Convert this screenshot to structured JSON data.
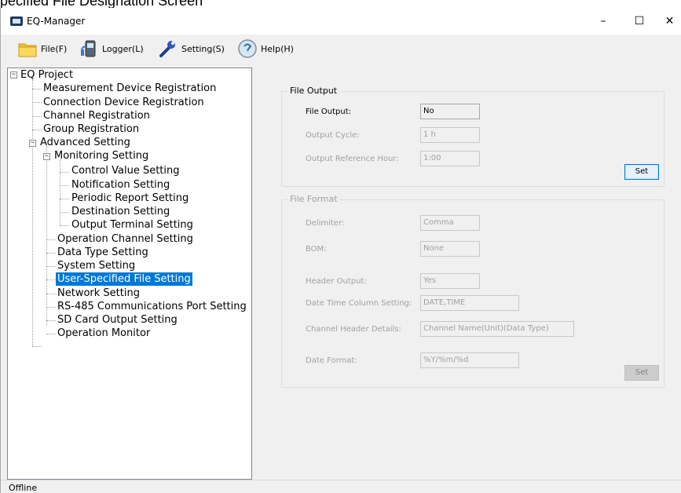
{
  "document": {
    "caption": "pecified File Designation Screen"
  },
  "window": {
    "title": "EQ-Manager",
    "minimize_glyph": "–",
    "maximize_glyph": "☐",
    "close_glyph": "✕"
  },
  "toolbar": {
    "file": {
      "label": "File(F)",
      "icon": "folder-icon"
    },
    "logger": {
      "label": "Logger(L)",
      "icon": "logger-device-icon"
    },
    "setting": {
      "label": "Setting(S)",
      "icon": "wrench-icon"
    },
    "help": {
      "label": "Help(H)",
      "icon": "help-icon"
    }
  },
  "tree": {
    "root": "EQ Project",
    "items": [
      "Measurement Device Registration",
      "Connection Device Registration",
      "Channel Registration",
      "Group Registration",
      "Advanced Setting",
      "Monitoring Setting",
      "Control Value Setting",
      "Notification Setting",
      "Periodic Report Setting",
      "Destination Setting",
      "Output Terminal Setting",
      "Operation Channel Setting",
      "Data Type Setting",
      "System Setting",
      "User-Specified File Setting",
      "Network Setting",
      "RS-485 Communications Port Setting",
      "SD Card Output Setting",
      "Operation Monitor"
    ],
    "selected": "User-Specified File Setting",
    "expander_glyph": "−"
  },
  "file_output": {
    "title": "File Output",
    "file_output_label": "File Output:",
    "file_output_value": "No",
    "output_cycle_label": "Output Cycle:",
    "output_cycle_value": "1 h",
    "ref_hour_label": "Output Reference Hour:",
    "ref_hour_value": "1:00",
    "set_label": "Set"
  },
  "file_format": {
    "title": "File Format",
    "delimiter_label": "Delimiter:",
    "delimiter_value": "Comma",
    "bom_label": "BOM:",
    "bom_value": "None",
    "header_output_label": "Header Output:",
    "header_output_value": "Yes",
    "dt_column_label": "Date Time Column Setting:",
    "dt_column_value": "DATE,TIME",
    "channel_header_label": "Channel Header Details:",
    "channel_header_value": "Channel Name(Unit)(Data Type)",
    "date_format_label": "Date Format:",
    "date_format_value": "%Y/%m/%d",
    "set_label": "Set"
  },
  "status": {
    "text": "Offline"
  },
  "colors": {
    "selection": "#0078d7",
    "window_bg": "#f0f0f0",
    "disabled_text": "#a0a0a0"
  }
}
